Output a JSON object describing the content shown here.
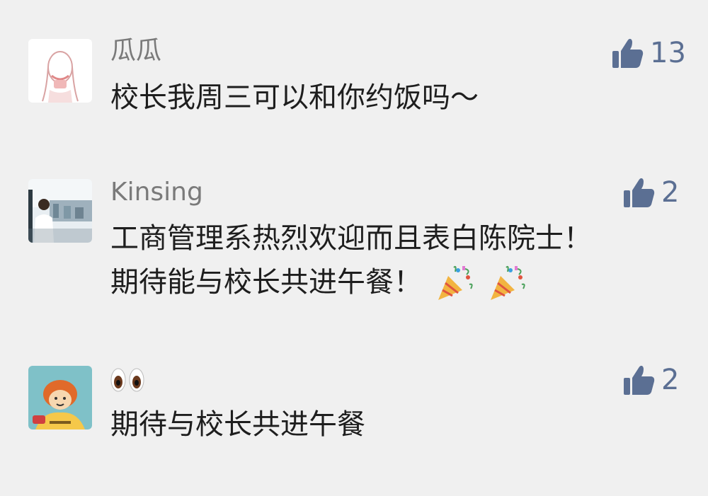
{
  "comments": [
    {
      "author": "瓜瓜",
      "text_lines": [
        "校长我周三可以和你约饭吗～"
      ],
      "likes": "13",
      "avatar": "girl-sketch-avatar"
    },
    {
      "author": "Kinsing",
      "text_lines": [
        "工商管理系热烈欢迎而且表白陈院士！",
        "期待能与校长共进午餐！"
      ],
      "likes": "2",
      "avatar": "city-view-photo-avatar",
      "emojis": [
        "party-popper-emoji",
        "party-popper-emoji"
      ]
    },
    {
      "author": "👀",
      "text_lines": [
        "期待与校长共进午餐"
      ],
      "likes": "2",
      "avatar": "cartoon-character-avatar"
    }
  ],
  "colors": {
    "background": "#f0f0f0",
    "like_accent": "#5b6f93",
    "name": "#7a7a7a",
    "text": "#1e1e1e"
  }
}
